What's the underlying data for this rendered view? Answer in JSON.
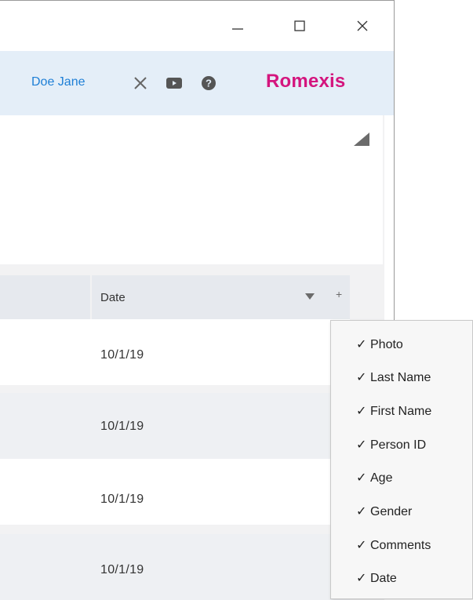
{
  "window_controls": {
    "minimize_icon": "minimize-icon",
    "maximize_icon": "maximize-icon",
    "close_icon": "close-icon"
  },
  "header": {
    "user_name": "Doe Jane",
    "brand": "Romexis",
    "brand_color": "#d4157e",
    "accent_color": "#1e7fd6",
    "background": "#e4eef8",
    "icons": [
      "close-x-icon",
      "video-icon",
      "help-icon"
    ]
  },
  "table": {
    "columns": [
      "Date"
    ],
    "rows": [
      {
        "date": "10/1/19"
      },
      {
        "date": "10/1/19"
      },
      {
        "date": "10/1/19"
      },
      {
        "date": "10/1/19"
      }
    ]
  },
  "column_menu": {
    "check_mark": "✓",
    "items": [
      {
        "label": "Photo",
        "checked": true
      },
      {
        "label": "Last Name",
        "checked": true
      },
      {
        "label": "First Name",
        "checked": true
      },
      {
        "label": "Person ID",
        "checked": true
      },
      {
        "label": "Age",
        "checked": true
      },
      {
        "label": "Gender",
        "checked": true
      },
      {
        "label": "Comments",
        "checked": true
      },
      {
        "label": "Date",
        "checked": true
      }
    ]
  }
}
